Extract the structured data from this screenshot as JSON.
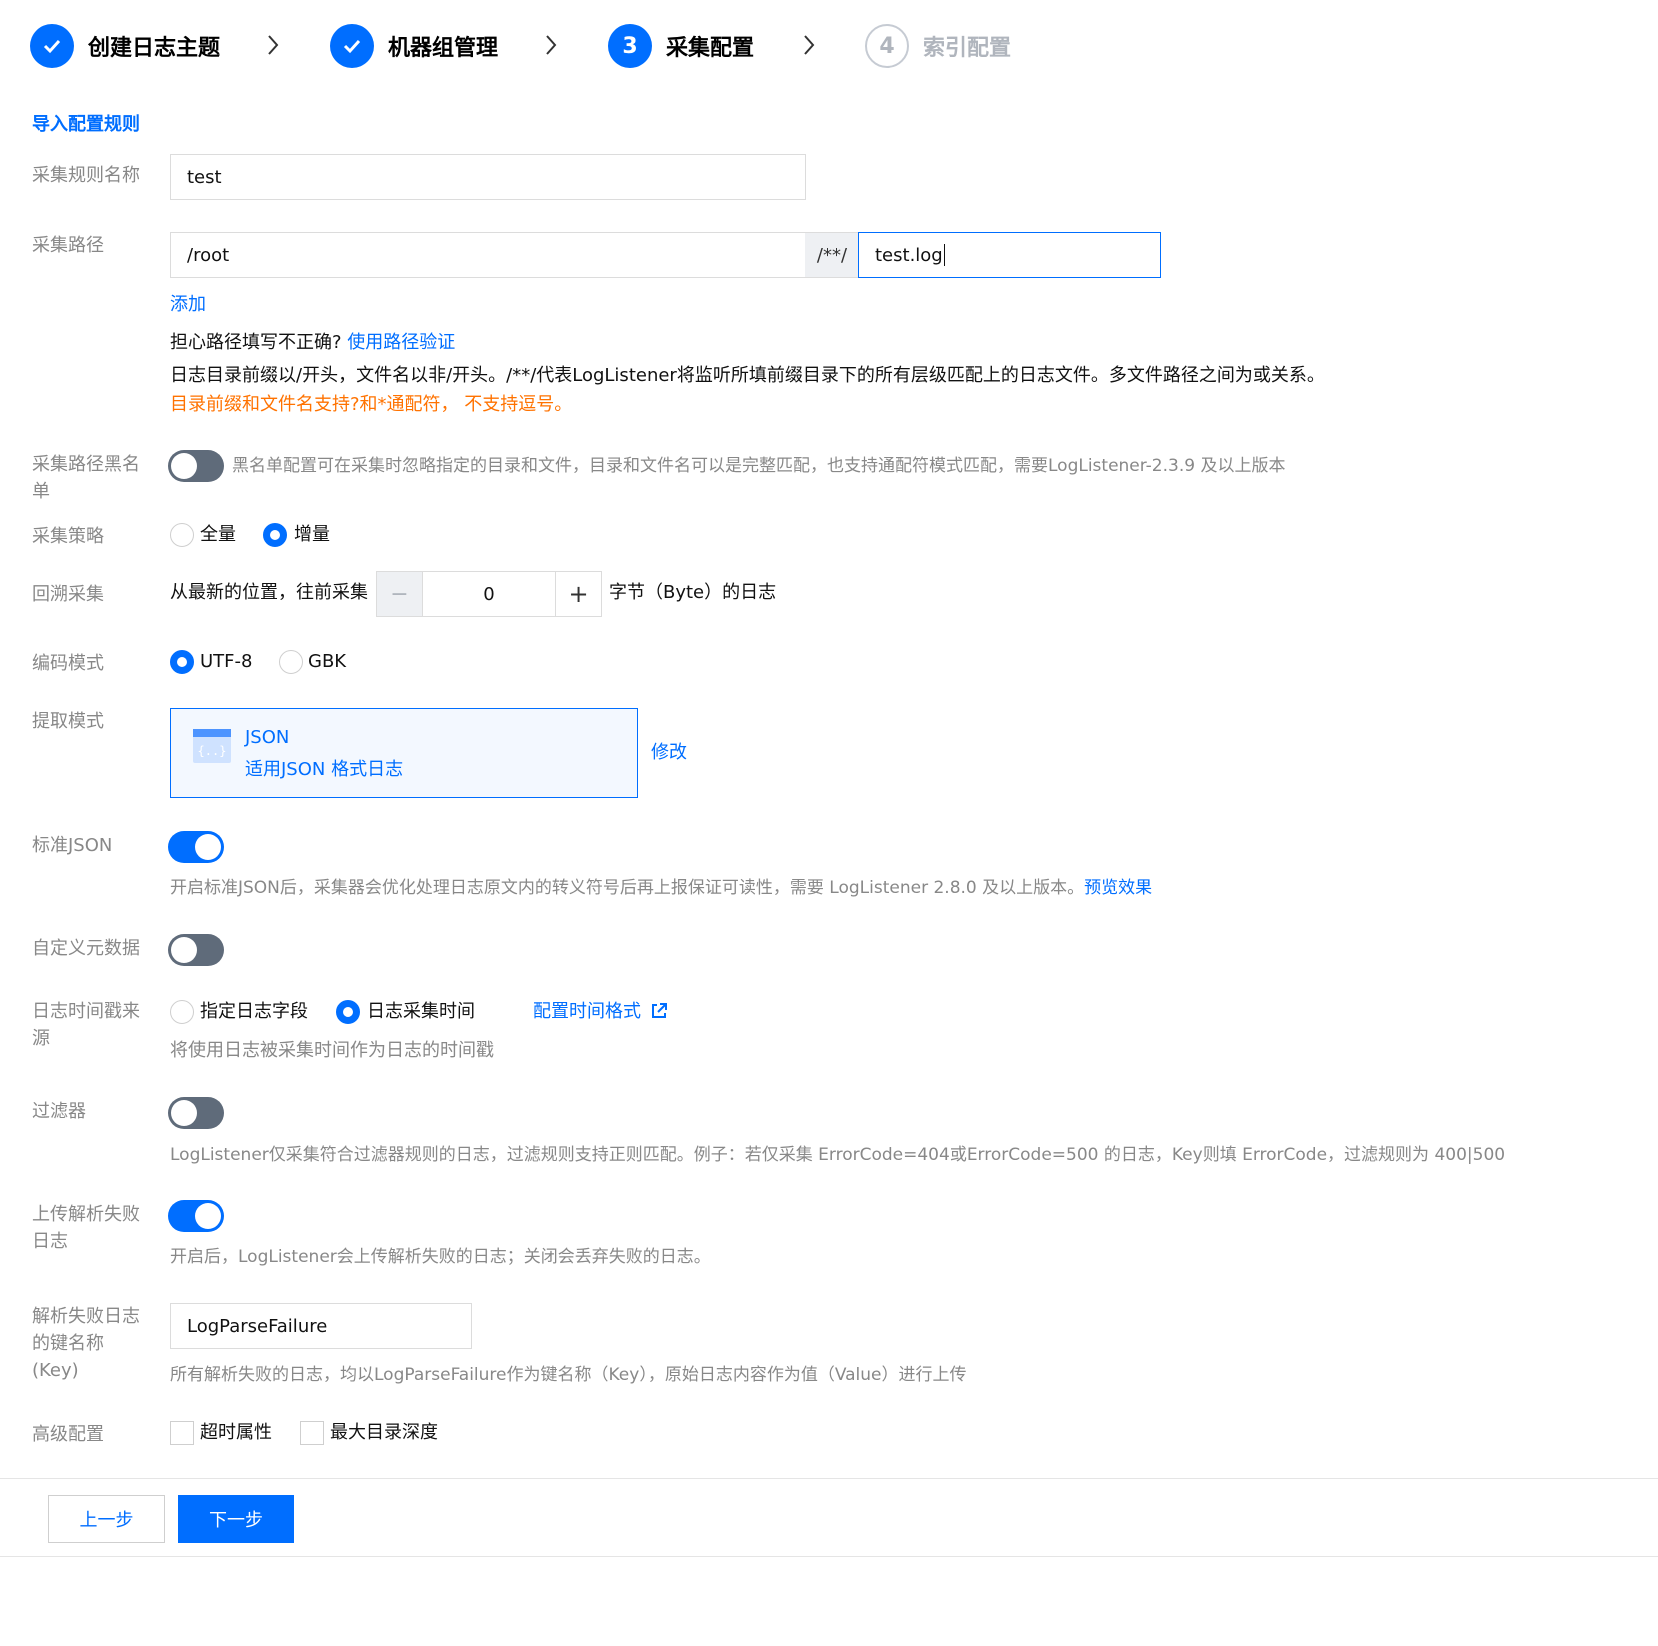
{
  "steps": [
    {
      "number": "",
      "label": "创建日志主题",
      "state": "done"
    },
    {
      "number": "",
      "label": "机器组管理",
      "state": "done"
    },
    {
      "number": "3",
      "label": "采集配置",
      "state": "active"
    },
    {
      "number": "4",
      "label": "索引配置",
      "state": "pending"
    }
  ],
  "import_rules_link": "导入配置规则",
  "rule_name": {
    "label": "采集规则名称",
    "value": "test"
  },
  "path": {
    "label": "采集路径",
    "dir_value": "/root",
    "separator": "/**/",
    "file_value": "test.log",
    "add_link": "添加",
    "hint_question": "担心路径填写不正确?",
    "verify_link": "使用路径验证",
    "desc": "日志目录前缀以/开头，文件名以非/开头。/**/代表LogListener将监听所填前缀目录下的所有层级匹配上的日志文件。多文件路径之间为或关系。",
    "warning": "目录前缀和文件名支持?和*通配符， 不支持逗号。"
  },
  "blacklist": {
    "label_line1": "采集路径黑名",
    "label_line2": "单",
    "desc": "黑名单配置可在采集时忽略指定的目录和文件，目录和文件名可以是完整匹配，也支持通配符模式匹配，需要LogListener-2.3.9 及以上版本",
    "enabled": false
  },
  "strategy": {
    "label": "采集策略",
    "options": [
      "全量",
      "增量"
    ],
    "selected": "增量"
  },
  "backtrack": {
    "label": "回溯采集",
    "prefix": "从最新的位置，往前采集",
    "minus": "−",
    "value": "0",
    "plus": "+",
    "suffix": "字节（Byte）的日志"
  },
  "encoding": {
    "label": "编码模式",
    "options": [
      "UTF-8",
      "GBK"
    ],
    "selected": "UTF-8"
  },
  "extract": {
    "label": "提取模式",
    "mode_title": "JSON",
    "mode_desc": "适用JSON 格式日志",
    "modify_link": "修改",
    "icon": "json-file-icon"
  },
  "standard_json": {
    "label": "标准JSON",
    "enabled": true,
    "desc": "开启标准JSON后，采集器会优化处理日志原文内的转义符号后再上报保证可读性，需要 LogListener 2.8.0 及以上版本。",
    "preview_link": "预览效果"
  },
  "custom_meta": {
    "label": "自定义元数据",
    "enabled": false
  },
  "timestamp_source": {
    "label_line1": "日志时间戳来",
    "label_line2": "源",
    "options": [
      "指定日志字段",
      "日志采集时间"
    ],
    "selected": "日志采集时间",
    "config_link": "配置时间格式",
    "desc": "将使用日志被采集时间作为日志的时间戳"
  },
  "filter": {
    "label": "过滤器",
    "enabled": false,
    "desc": "LogListener仅采集符合过滤器规则的日志，过滤规则支持正则匹配。例子：若仅采集 ErrorCode=404或ErrorCode=500 的日志，Key则填 ErrorCode，过滤规则为 400|500"
  },
  "upload_failed": {
    "label_line1": "上传解析失败",
    "label_line2": "日志",
    "enabled": true,
    "desc": "开启后，LogListener会上传解析失败的日志；关闭会丢弃失败的日志。"
  },
  "failed_key": {
    "label_line1": "解析失败日志",
    "label_line2": "的键名称",
    "label_line3": "(Key)",
    "value": "LogParseFailure",
    "desc": "所有解析失败的日志，均以LogParseFailure作为键名称（Key），原始日志内容作为值（Value）进行上传"
  },
  "advanced": {
    "label": "高级配置",
    "options": [
      "超时属性",
      "最大目录深度"
    ]
  },
  "footer": {
    "prev": "上一步",
    "next": "下一步"
  },
  "colors": {
    "primary": "#006eff",
    "warning": "#ff7200",
    "muted": "#888888"
  }
}
